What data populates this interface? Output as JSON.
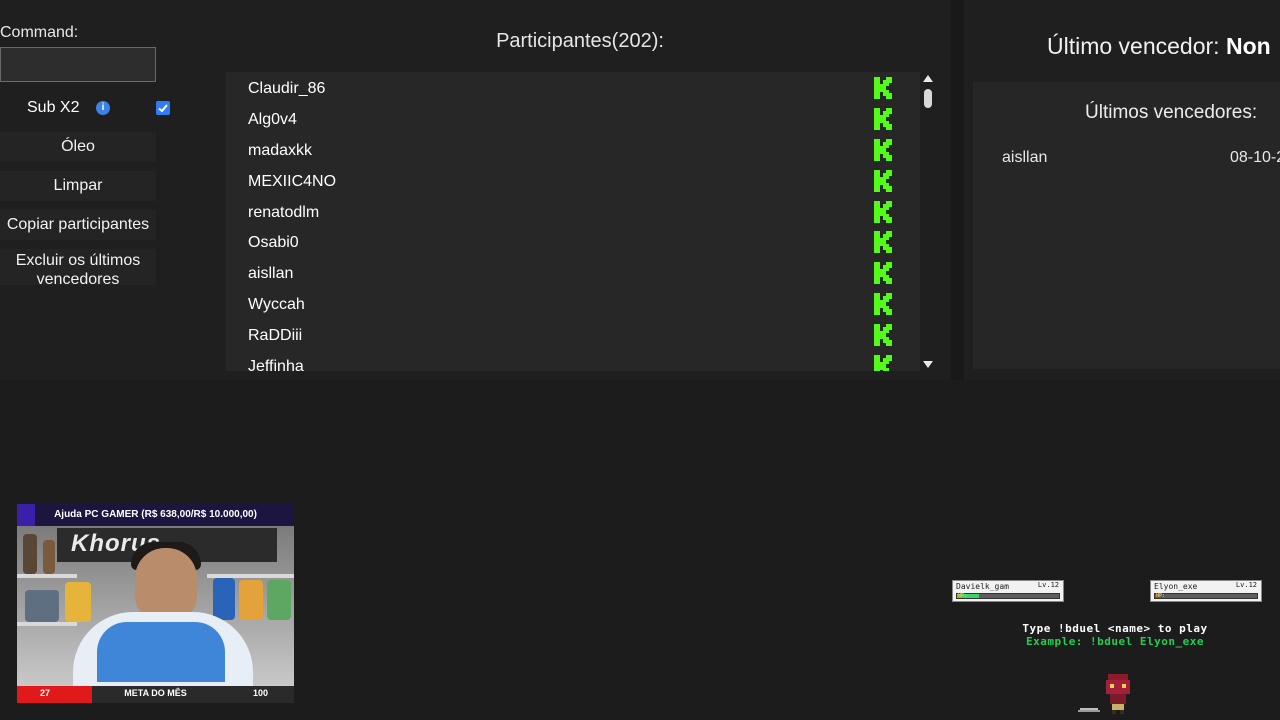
{
  "controls": {
    "command_label": "Command:",
    "command_value": "",
    "sub_label": "Sub X2",
    "info_glyph": "i",
    "sub_checked": true,
    "oleo_label": "Óleo",
    "limpar_label": "Limpar",
    "copiar_label": "Copiar participantes",
    "excluir_label_line1": "Excluir os últimos",
    "excluir_label_line2": "vencedores"
  },
  "participants": {
    "title": "Participantes(202):",
    "platform_icon": "kick-logo-icon",
    "accent_color": "#53fc18",
    "items": [
      {
        "name": "Claudir_86"
      },
      {
        "name": "Alg0v4"
      },
      {
        "name": "madaxkk"
      },
      {
        "name": "MEXIIC4NO"
      },
      {
        "name": "renatodlm"
      },
      {
        "name": "Osabi0"
      },
      {
        "name": "aisllan"
      },
      {
        "name": "Wyccah"
      },
      {
        "name": "RaDDiii"
      },
      {
        "name": "Jeffinha"
      }
    ]
  },
  "winner": {
    "label": "Último vencedor:",
    "value": "Non",
    "list_title": "Últimos vencedores:",
    "rows": [
      {
        "name": "aisllan",
        "date": "08-10-2"
      }
    ]
  },
  "webcam": {
    "goal_text": "Ajuda PC GAMER (R$ 638,00/R$ 10.000,00)",
    "poster_text": "Khorus",
    "bar_left": "27",
    "bar_center": "META DO MÊS",
    "bar_right": "100",
    "bar_progress": 0.27,
    "bar_color": "#e01a1a"
  },
  "duel": {
    "player1_name": "Davielk_gam",
    "player1_level": "Lv.12",
    "player1_hp": 0.22,
    "player2_name": "Elyon_exe",
    "player2_level": "Lv.12",
    "player2_hp": 0.0,
    "hp_label": "HP:",
    "instruction": "Type !bduel <name> to play",
    "example": "Example: !bduel Elyon_exe"
  }
}
